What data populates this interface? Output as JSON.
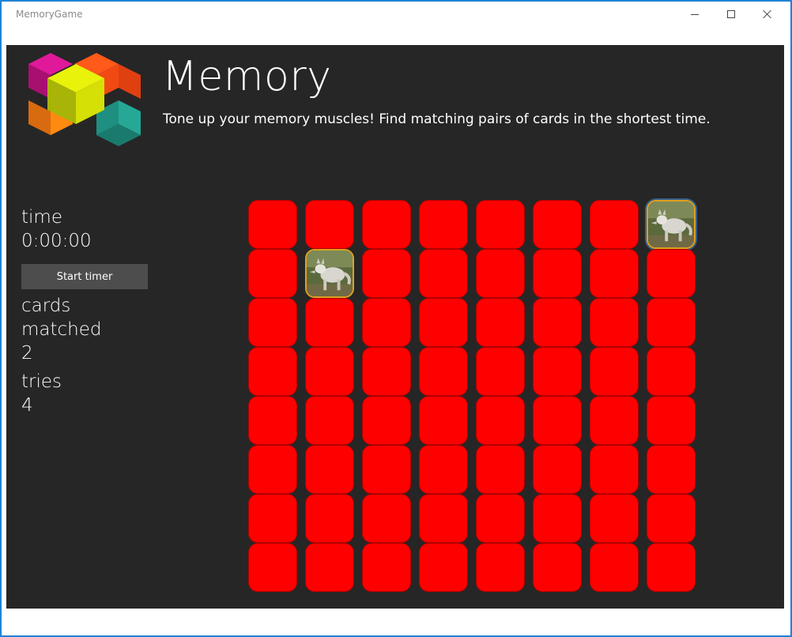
{
  "window": {
    "title": "MemoryGame"
  },
  "header": {
    "title": "Memory",
    "subtitle": "Tone up your memory muscles! Find matching pairs of cards in the shortest time.",
    "logo_icon": "color-cubes-logo"
  },
  "stats": {
    "time_label": "time",
    "time_value": "0:00:00",
    "start_button": "Start timer",
    "matched_label_1": "cards",
    "matched_label_2": "matched",
    "matched_value": "2",
    "tries_label": "tries",
    "tries_value": "4"
  },
  "board": {
    "rows": 8,
    "columns": 8,
    "card_color": "#ff0000",
    "revealed_cards": [
      {
        "row": 1,
        "column": 8,
        "image": "wolf-photo"
      },
      {
        "row": 2,
        "column": 2,
        "image": "wolf-photo"
      }
    ]
  }
}
